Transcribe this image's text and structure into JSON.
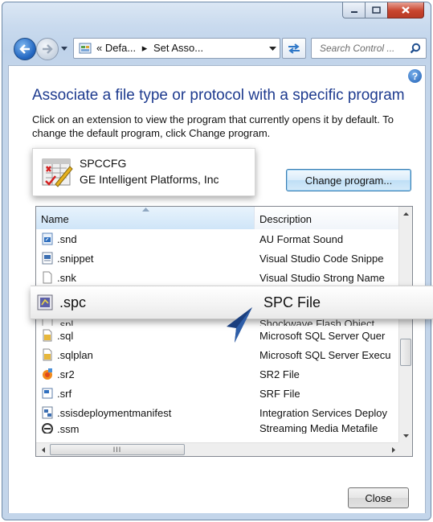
{
  "nav": {
    "breadcrumb_prefix": "«",
    "crumb_1": "Defa...",
    "crumb_sep": "▸",
    "crumb_2": "Set Asso...",
    "search_placeholder": "Search Control ..."
  },
  "page": {
    "title": "Associate a file type or protocol with a specific program",
    "description": "Click on an extension to view the program that currently opens it by default. To change the default program, click Change program.",
    "help_glyph": "?"
  },
  "current_program": {
    "name": "SPCCFG",
    "publisher": "GE Intelligent Platforms, Inc",
    "icon": "spccfg-app-icon"
  },
  "buttons": {
    "change_program": "Change program...",
    "close": "Close"
  },
  "list": {
    "columns": {
      "name": "Name",
      "description": "Description"
    },
    "rows_top": [
      {
        "name": ".snd",
        "description": "AU Format Sound",
        "icon": "sound-file-icon"
      },
      {
        "name": ".snippet",
        "description": "Visual Studio Code Snippe",
        "icon": "snippet-file-icon"
      },
      {
        "name": ".snk",
        "description": "Visual Studio Strong Name",
        "icon": "blank-file-icon"
      },
      {
        "name": ".spl",
        "description": "Shockwave Flash Object",
        "icon": "flash-file-icon"
      }
    ],
    "rows_bottom": [
      {
        "name": ".sql",
        "description": "Microsoft SQL Server Quer",
        "icon": "sql-file-icon"
      },
      {
        "name": ".sqlplan",
        "description": "Microsoft SQL Server Execu",
        "icon": "sqlplan-file-icon"
      },
      {
        "name": ".sr2",
        "description": "SR2 File",
        "icon": "sr2-file-icon"
      },
      {
        "name": ".srf",
        "description": "SRF File",
        "icon": "srf-file-icon"
      },
      {
        "name": ".ssisdeploymentmanifest",
        "description": "Integration Services Deploy",
        "icon": "ssis-file-icon"
      },
      {
        "name": ".ssm",
        "description": "Streaming Media Metafile",
        "icon": "streaming-file-icon"
      }
    ],
    "hscroll_grip": "III"
  },
  "callout": {
    "name": ".spc",
    "description": "SPC File",
    "icon": "spc-file-icon"
  },
  "colors": {
    "title_blue": "#1e3b8f",
    "frame_blue": "#c9daee",
    "close_red": "#c8442d",
    "pointer_blue": "#1b3f7e"
  }
}
